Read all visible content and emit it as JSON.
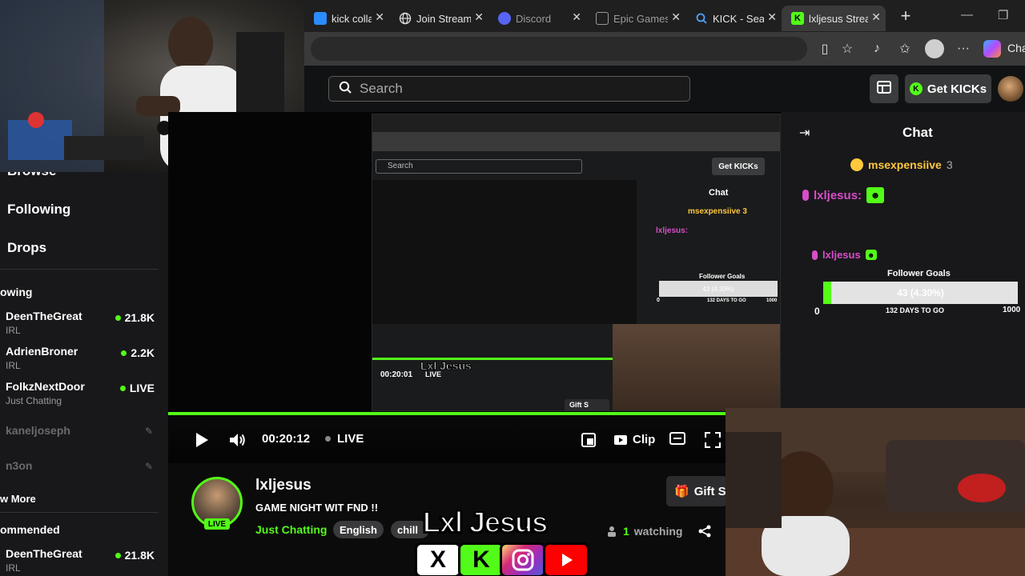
{
  "browser": {
    "tabs": [
      {
        "label": "kick collab -",
        "icon": "kick-collab-icon",
        "active": false
      },
      {
        "label": "Join Stream",
        "icon": "globe-icon",
        "active": false
      },
      {
        "label": "Discord",
        "icon": "discord-icon",
        "active": false
      },
      {
        "label": "Epic Games",
        "icon": "document-icon",
        "active": false
      },
      {
        "label": "KICK - Searc",
        "icon": "search-icon",
        "active": false
      },
      {
        "label": "lxljesus Strea",
        "icon": "kick-icon",
        "active": true
      }
    ],
    "copilot_label": "Cha",
    "colors": {
      "tabbar": "#1f1f1f",
      "active_tab": "#3a3a3a"
    }
  },
  "header": {
    "search_placeholder": "Search",
    "get_kicks_label": "Get KICKs",
    "accent": "#53fc18"
  },
  "sidebar": {
    "nav": [
      {
        "label": "Browse"
      },
      {
        "label": "Following"
      },
      {
        "label": "Drops"
      }
    ],
    "following_heading": "owing",
    "following": [
      {
        "name": "DeenTheGreat",
        "category": "IRL",
        "count": "21.8K",
        "online": true
      },
      {
        "name": "AdrienBroner",
        "category": "IRL",
        "count": "2.2K",
        "online": true
      },
      {
        "name": "FolkzNextDoor",
        "category": "Just Chatting",
        "count": "LIVE",
        "online": true
      },
      {
        "name": "kaneljoseph",
        "online": false
      },
      {
        "name": "n3on",
        "online": false
      }
    ],
    "show_more": "w More",
    "recommended_heading": "ommended",
    "recommended": [
      {
        "name": "DeenTheGreat",
        "category": "IRL",
        "count": "21.8K"
      }
    ]
  },
  "player": {
    "time": "00:20:12",
    "live_label": "LIVE",
    "clip_label": "Clip",
    "progress_fraction": 1.0
  },
  "nested_capture": {
    "search_placeholder": "Search",
    "get_kicks_label": "Get KICKs",
    "chat_title": "Chat",
    "gifter": "msexpensiive 3",
    "chat_user": "lxljesus:",
    "goal_title": "Follower Goals",
    "goal_text": "43 (4.30%)",
    "goal_days": "132 DAYS TO GO",
    "goal_min": "0",
    "goal_max": "1000",
    "time": "00:20:01",
    "live": "LIVE",
    "brand": "Lxl Jesus",
    "gift_label": "Gift S",
    "tags": [
      "English",
      "chil"
    ],
    "watching": "1 watching",
    "clip": "Clip",
    "title_fragment": "FND !!"
  },
  "chat": {
    "title": "Chat",
    "gifter_name": "msexpensiive",
    "gifter_count": "3",
    "messages": [
      {
        "user": "lxljesus:",
        "emote": "kick-emote"
      },
      {
        "user": "lxljesus",
        "emote": "kick-emote"
      }
    ],
    "goal": {
      "title": "Follower Goals",
      "current": 43,
      "target": 1000,
      "label": "43 (4.30%)",
      "min_label": "0",
      "max_label": "1000",
      "days_label": "132 DAYS TO GO"
    }
  },
  "stream_info": {
    "streamer": "lxljesus",
    "live_badge": "LIVE",
    "title": "GAME NIGHT WIT FND !!",
    "category": "Just Chatting",
    "tags": [
      "English",
      "chill"
    ],
    "watching_count": "1",
    "watching_label": "watching",
    "gift_label": "Gift S"
  },
  "branding": {
    "title": "Lxl Jesus",
    "icons": [
      "x-icon",
      "kick-icon",
      "instagram-icon",
      "youtube-icon"
    ],
    "icon_labels": [
      "X",
      "K",
      "",
      ""
    ]
  }
}
